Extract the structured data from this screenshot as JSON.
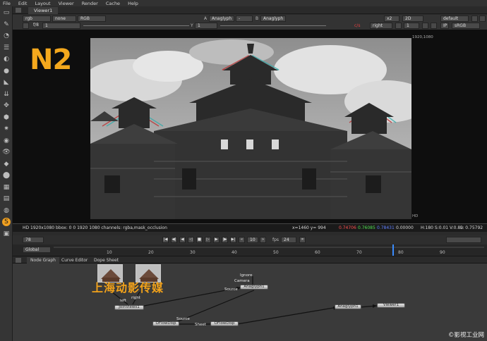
{
  "menu": [
    "File",
    "Edit",
    "Layout",
    "Viewer",
    "Render",
    "Cache",
    "Help"
  ],
  "viewer": {
    "tab_label": "Viewer1",
    "row1": {
      "channels": "rgb",
      "alpha": "none",
      "display_channels": "RGB",
      "a_label": "A",
      "a_input": "Anaglyph",
      "a_op": "-",
      "b_label": "B",
      "b_input": "Anaglyph",
      "zoom": "x2",
      "view_mode": "2D",
      "lut": "default"
    },
    "row2": {
      "frame_ratio": "f/8",
      "gain": "1",
      "y_label": "Y",
      "y_value": "1",
      "roi_marker": "c/s",
      "view": "right",
      "proxy": "1",
      "ip": "IP",
      "colorspace": "sRGB"
    },
    "overlay_title": "N2",
    "format_corner": "1920,1080",
    "format_hd": "HD",
    "info": {
      "format": "HD 1920x1080 bbox: 0 0 1920 1080 channels: rgba,mask_occlusion",
      "coords": "x=1460 y= 994",
      "r": "0.74706",
      "g": "0.76085",
      "b": "0.78431",
      "a": "0.00000",
      "hsv": "H:180 S:0.01 V:0.89",
      "l": "L: 0.75792"
    }
  },
  "timeline": {
    "frame": "78",
    "fps_label": "fps",
    "fps": "24",
    "scope": "Global",
    "step": "10",
    "ticks": [
      "10",
      "20",
      "30",
      "40",
      "50",
      "60",
      "70",
      "80",
      "90"
    ],
    "current_frame": 78
  },
  "nodegraph": {
    "tabs": [
      "Node Graph",
      "Curve Editor",
      "Dope Sheet"
    ],
    "chinese_text": "上海动影传媒",
    "nodes": {
      "join": "JoinViews1",
      "anaglyph_in": "Anaglyph1",
      "anaglyph_out": "Anaglyph1",
      "viewer": "Viewer1",
      "oflow1": "OFlowDisp",
      "oflow2": "OFlowDisp"
    },
    "pipes": {
      "left": "left",
      "right": "right",
      "ignore": "Ignore",
      "camera": "Camera",
      "source": "Source",
      "source2": "Source",
      "sheet": "Sheet"
    }
  },
  "watermark": "©影视工业网",
  "colors": {
    "accent": "#f4a81d",
    "panel": "#2b2b2b",
    "nodegraph_bg": "#3a3a3a",
    "viewer_bg": "#0e0e0e",
    "playhead": "#3a8cff"
  }
}
